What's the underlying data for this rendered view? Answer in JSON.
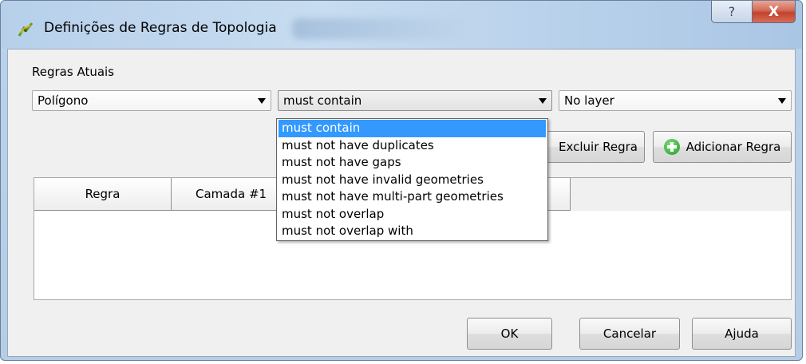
{
  "window": {
    "title": "Definições de Regras de Topologia",
    "help_label": "?",
    "close_label": "X"
  },
  "rules_label": "Regras Atuais",
  "combos": {
    "layer_type": "Polígono",
    "rule": "must contain",
    "layer2": "No layer"
  },
  "rule_options": [
    "must contain",
    "must not have duplicates",
    "must not have gaps",
    "must not have invalid geometries",
    "must not have multi-part geometries",
    "must not overlap",
    "must not overlap with"
  ],
  "selected_rule_index": 0,
  "buttons": {
    "delete_rule": "Excluir Regra",
    "add_rule": "Adicionar Regra",
    "ok": "OK",
    "cancel": "Cancelar",
    "help": "Ajuda"
  },
  "table": {
    "columns": [
      "Regra",
      "Camada #1"
    ]
  },
  "colors": {
    "selection": "#3399ff",
    "close_button": "#c2432c",
    "title_bar": "#b9d1ea"
  },
  "icons": {
    "app": "qgis-topology-icon",
    "add": "green-plus-icon"
  }
}
